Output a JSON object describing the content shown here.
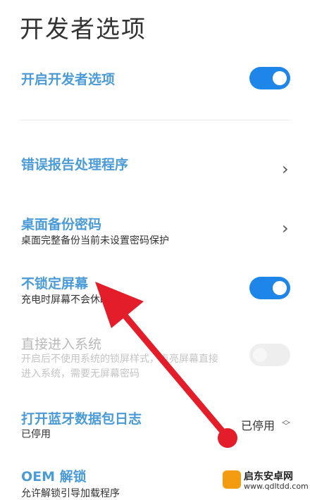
{
  "page": {
    "title": "开发者选项"
  },
  "settings": {
    "enable_dev": {
      "label": "开启开发者选项",
      "toggle": "on"
    },
    "bug_report": {
      "label": "错误报告处理程序"
    },
    "backup_password": {
      "label": "桌面备份密码",
      "subtitle": "桌面完整备份当前未设置密码保护"
    },
    "stay_awake": {
      "label": "不锁定屏幕",
      "subtitle": "充电时屏幕不会休眠",
      "toggle": "on"
    },
    "direct_enter": {
      "label": "直接进入系统",
      "subtitle_line1": "开启后不使用系统的锁屏样式，点亮屏幕直接",
      "subtitle_line2": "进入系统，需要无屏幕密码",
      "toggle": "off"
    },
    "bt_log": {
      "label": "打开蓝牙数据包日志",
      "subtitle": "已停用",
      "value": "已停用"
    },
    "oem_unlock": {
      "label": "OEM 解锁",
      "subtitle": "允许解锁引导加载程序"
    }
  },
  "watermark": {
    "name": "启东安卓网",
    "url": "www.qdltdd.com"
  },
  "colors": {
    "accent": "#4b9bd8",
    "toggle_on": "#1e86e8",
    "arrow": "#e31e2a"
  }
}
